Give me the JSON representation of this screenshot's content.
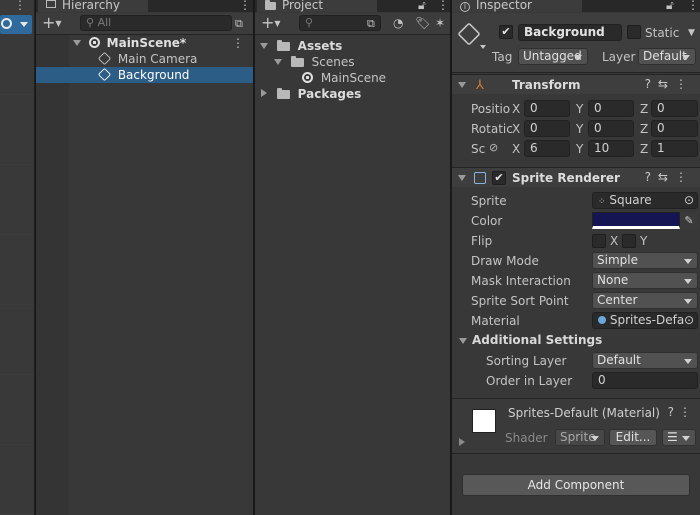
{
  "hierarchy": {
    "tab": "Hierarchy",
    "search_placeholder": "All",
    "scene": "MainScene*",
    "items": [
      "Main Camera",
      "Background"
    ]
  },
  "project": {
    "tab": "Project",
    "tree": {
      "assets": "Assets",
      "scenes": "Scenes",
      "mainscene": "MainScene",
      "packages": "Packages"
    }
  },
  "inspector": {
    "tab": "Inspector",
    "object_name": "Background",
    "static_label": "Static",
    "tag_label": "Tag",
    "tag_value": "Untagged",
    "layer_label": "Layer",
    "layer_value": "Default",
    "transform": {
      "title": "Transform",
      "position_label": "Positio",
      "rotation_label": "Rotatic",
      "scale_label": "Sc",
      "axes": [
        "X",
        "Y",
        "Z"
      ],
      "position": [
        "0",
        "0",
        "0"
      ],
      "rotation": [
        "0",
        "0",
        "0"
      ],
      "scale": [
        "6",
        "10",
        "1"
      ]
    },
    "sprite_renderer": {
      "title": "Sprite Renderer",
      "sprite_label": "Sprite",
      "sprite_value": "Square",
      "color_label": "Color",
      "color_value": "#141552",
      "flip_label": "Flip",
      "flip_x": "X",
      "flip_y": "Y",
      "draw_mode_label": "Draw Mode",
      "draw_mode_value": "Simple",
      "mask_label": "Mask Interaction",
      "mask_value": "None",
      "sort_point_label": "Sprite Sort Point",
      "sort_point_value": "Center",
      "material_label": "Material",
      "material_value": "Sprites-Defa",
      "additional_label": "Additional Settings",
      "sorting_layer_label": "Sorting Layer",
      "sorting_layer_value": "Default",
      "order_label": "Order in Layer",
      "order_value": "0"
    },
    "material": {
      "title": "Sprites-Default (Material)",
      "shader_label": "Shader",
      "shader_value": "Sprite",
      "edit_label": "Edit..."
    },
    "add_component": "Add Component"
  }
}
